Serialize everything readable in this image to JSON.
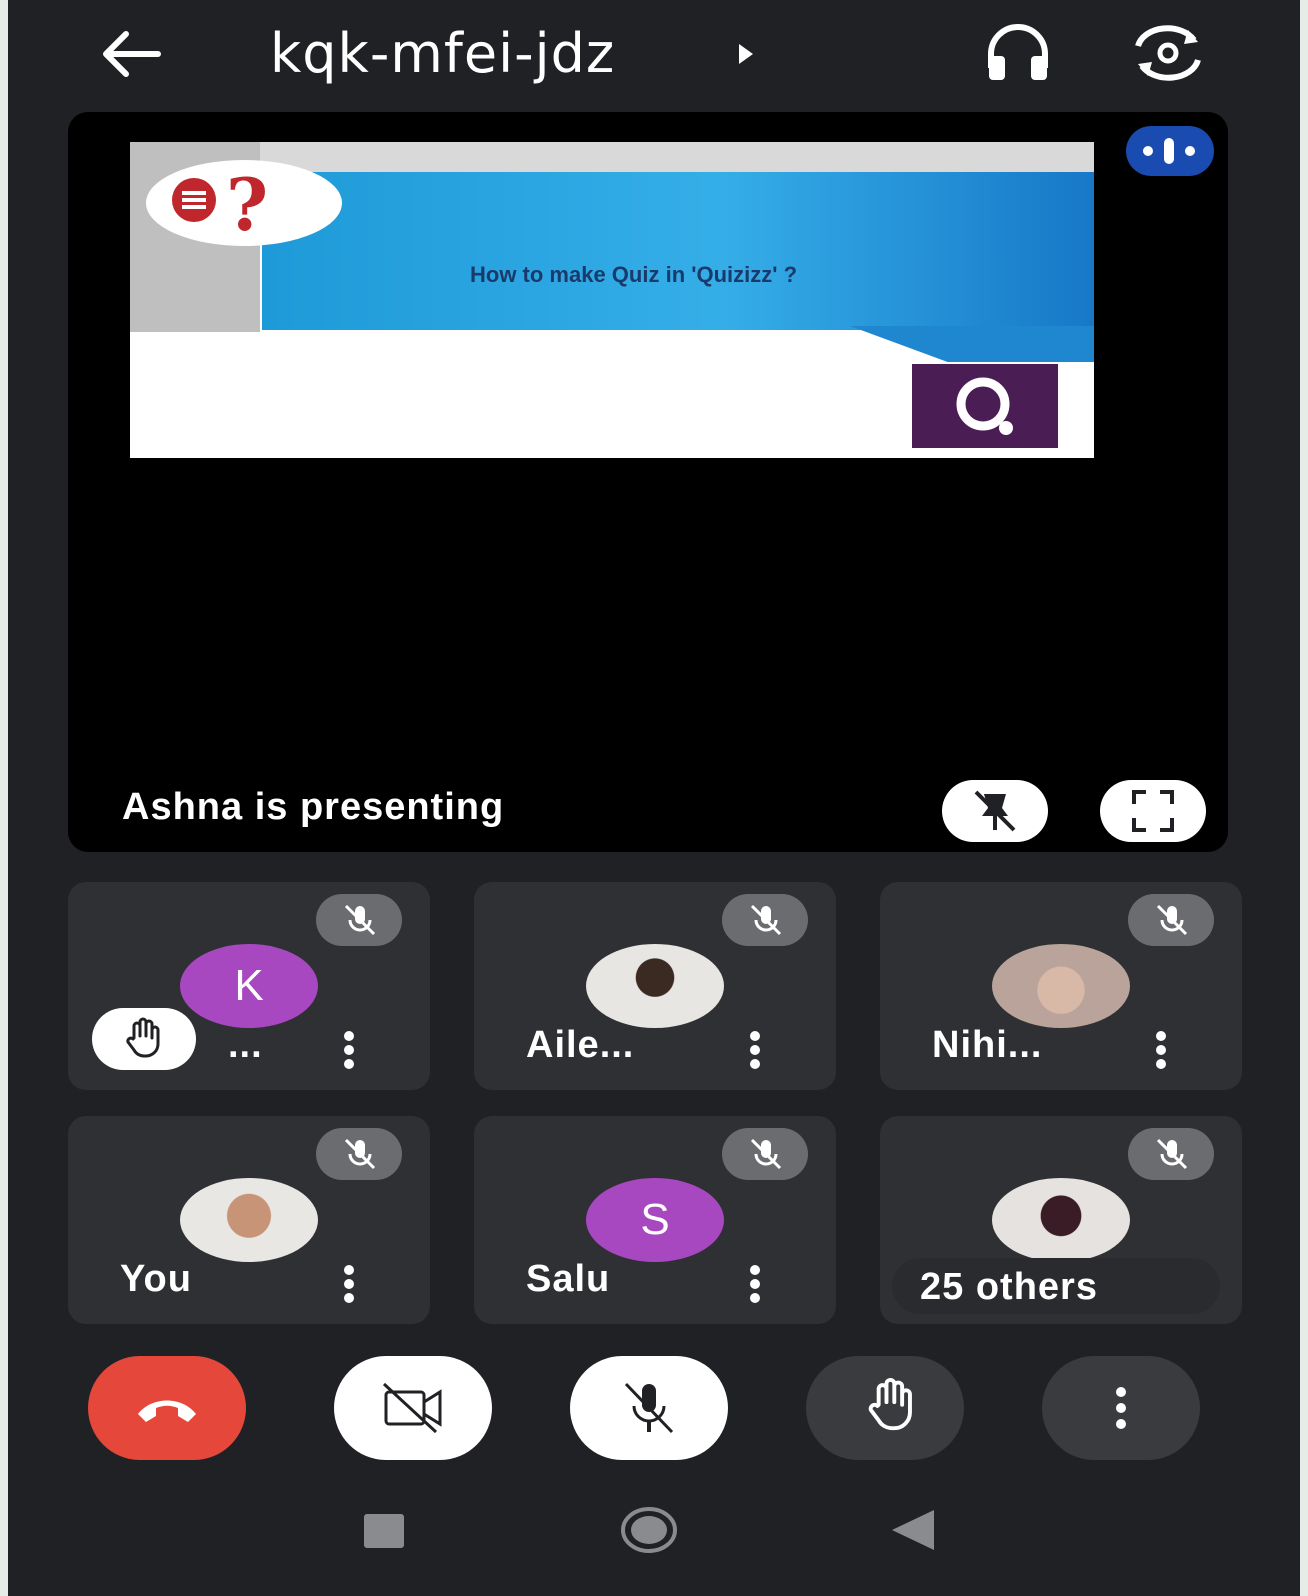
{
  "header": {
    "meeting_code": "kqk-mfei-jdz",
    "back_icon": "arrow-left-icon",
    "audio_icon": "headphones-icon",
    "camera_switch_icon": "switch-camera-icon"
  },
  "presentation": {
    "slide_title": "How to make Quiz in 'Quizizz' ?",
    "presenting_label": "Ashna is presenting",
    "unpin_icon": "unpin-icon",
    "fullscreen_icon": "fullscreen-icon"
  },
  "participants": [
    {
      "name": "...",
      "avatar_letter": "K",
      "avatar_color": "#a848c0",
      "hand_raised": true,
      "muted": true
    },
    {
      "name": "Aile...",
      "avatar_type": "photo",
      "muted": true
    },
    {
      "name": "Nihi...",
      "avatar_type": "photo",
      "muted": true
    },
    {
      "name": "You",
      "avatar_type": "photo",
      "muted": true
    },
    {
      "name": "Salu",
      "avatar_letter": "S",
      "avatar_color": "#a848c0",
      "muted": true
    },
    {
      "name": "25 others",
      "avatar_type": "photo",
      "muted": true
    }
  ],
  "controls": {
    "end_call_color": "#e5483a",
    "items": [
      "end-call-icon",
      "camera-off-icon",
      "mic-off-icon",
      "raise-hand-icon",
      "more-vert-icon"
    ]
  },
  "colors": {
    "background": "#202124",
    "tile": "#2f3033",
    "accent_blue": "#1a4bb0"
  }
}
